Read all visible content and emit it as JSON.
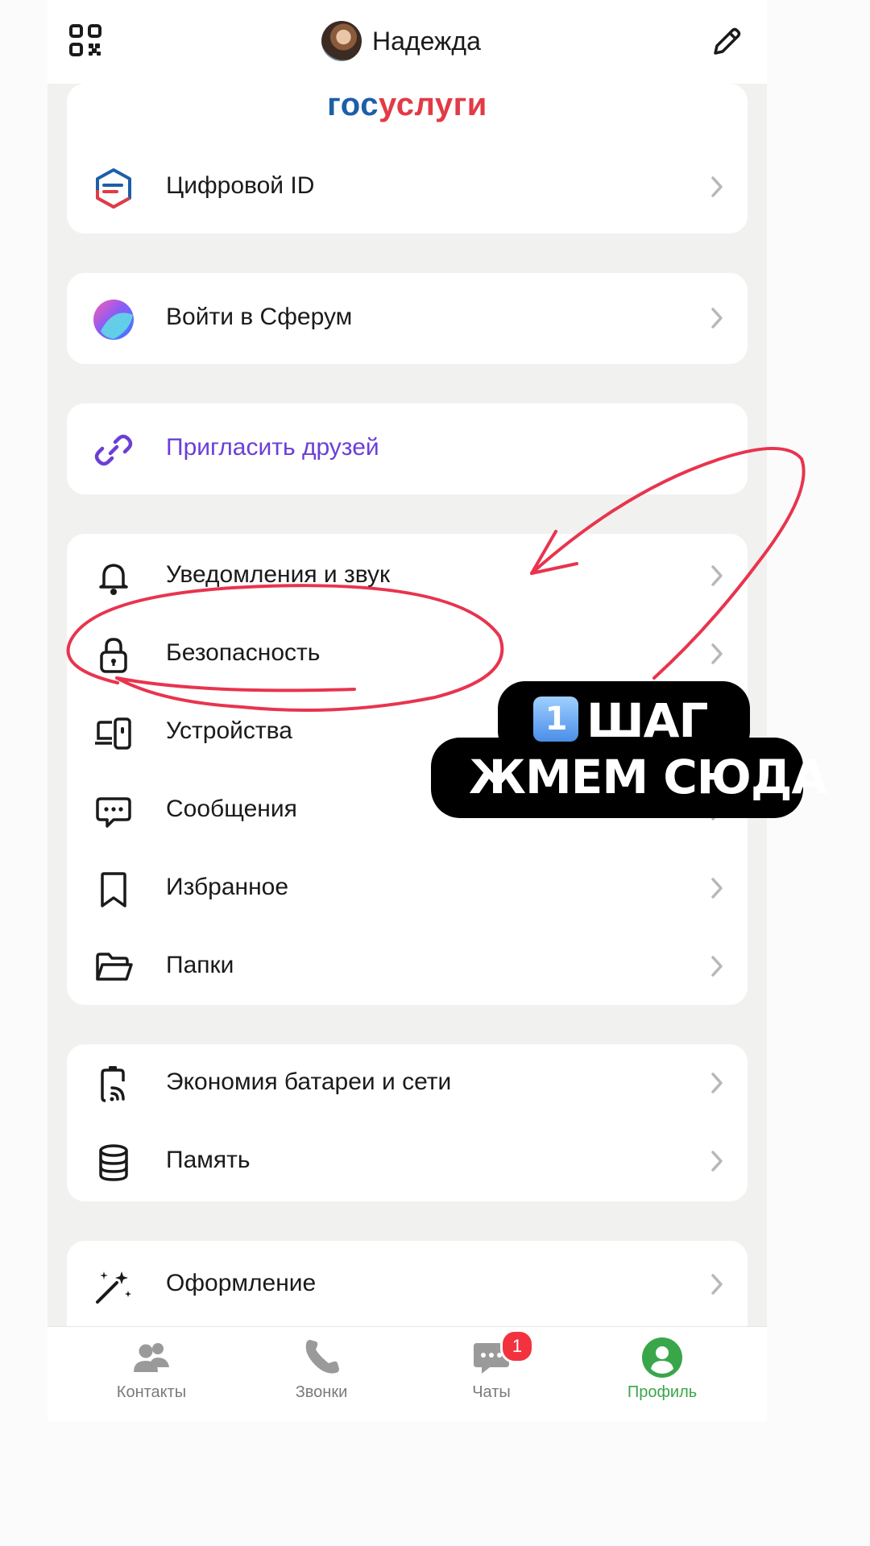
{
  "header": {
    "profile_name": "Надежда",
    "qr_icon": "qr-code-icon",
    "edit_icon": "pencil-icon"
  },
  "gosuslugi": {
    "logo_part1": "гос",
    "logo_part2": "услуги",
    "digital_id_label": "Цифровой ID"
  },
  "sferum": {
    "label": "Войти в Сферум"
  },
  "invite": {
    "label": "Пригласить друзей",
    "color": "#6b3fd6"
  },
  "settings": {
    "items": [
      {
        "label": "Уведомления и звук",
        "icon": "bell-icon"
      },
      {
        "label": "Безопасность",
        "icon": "lock-icon"
      },
      {
        "label": "Устройства",
        "icon": "devices-icon"
      },
      {
        "label": "Сообщения",
        "icon": "message-icon"
      },
      {
        "label": "Избранное",
        "icon": "bookmark-icon"
      },
      {
        "label": "Папки",
        "icon": "folder-icon"
      }
    ]
  },
  "system": {
    "items": [
      {
        "label": "Экономия батареи и сети",
        "icon": "battery-icon"
      },
      {
        "label": "Память",
        "icon": "storage-icon"
      }
    ]
  },
  "appearance": {
    "label": "Оформление",
    "icon": "magic-wand-icon"
  },
  "tabbar": {
    "tabs": [
      {
        "label": "Контакты",
        "icon": "contacts-icon"
      },
      {
        "label": "Звонки",
        "icon": "phone-icon"
      },
      {
        "label": "Чаты",
        "icon": "chat-icon",
        "badge": "1"
      },
      {
        "label": "Профиль",
        "icon": "profile-icon",
        "active": true
      }
    ]
  },
  "annotation": {
    "step_number": "1",
    "line1": "ШАГ",
    "line2": "ЖМЕМ СЮДА",
    "color": "#e8344e"
  }
}
